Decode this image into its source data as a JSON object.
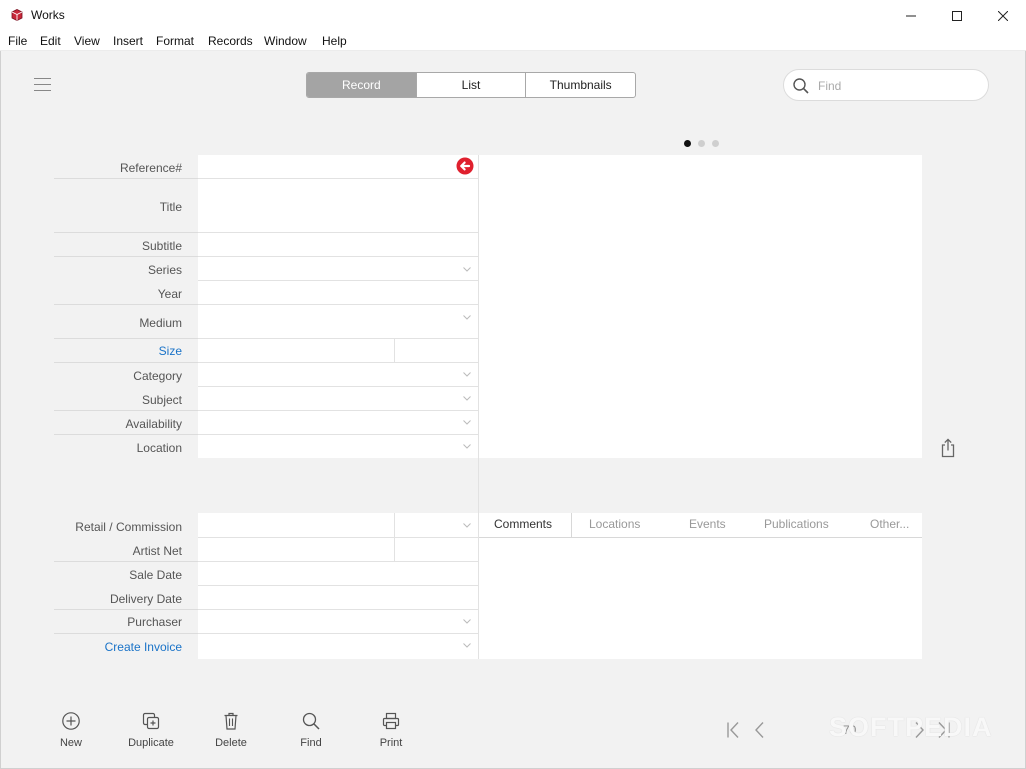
{
  "window": {
    "title": "Works"
  },
  "menu": [
    "File",
    "Edit",
    "View",
    "Insert",
    "Format",
    "Records",
    "Window",
    "Help"
  ],
  "view_tabs": {
    "record": "Record",
    "list": "List",
    "thumbnails": "Thumbnails",
    "active": "Record"
  },
  "search": {
    "placeholder": "Find",
    "value": ""
  },
  "image_pager": {
    "pages": 3,
    "current": 1
  },
  "fields": {
    "reference": "Reference#",
    "title": "Title",
    "subtitle": "Subtitle",
    "series": "Series",
    "year": "Year",
    "medium": "Medium",
    "size": "Size",
    "category": "Category",
    "subject": "Subject",
    "availability": "Availability",
    "location": "Location",
    "retail_commission": "Retail / Commission",
    "artist_net": "Artist Net",
    "sale_date": "Sale Date",
    "delivery_date": "Delivery Date",
    "purchaser": "Purchaser",
    "create_invoice": "Create Invoice"
  },
  "detail_tabs": {
    "comments": "Comments",
    "locations": "Locations",
    "events": "Events",
    "publications": "Publications",
    "other": "Other..."
  },
  "toolbar": {
    "new": "New",
    "duplicate": "Duplicate",
    "delete": "Delete",
    "find": "Find",
    "print": "Print"
  },
  "navigation": {
    "count": "70"
  },
  "watermark": "SOFTPEDIA",
  "colors": {
    "accent_link": "#1a73c8",
    "add_button": "#e0202e",
    "active_segment": "#a4a4a4"
  }
}
